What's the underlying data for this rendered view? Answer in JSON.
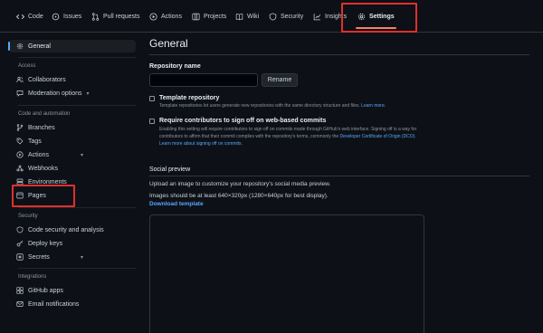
{
  "nav": {
    "tabs": [
      {
        "id": "code",
        "label": "Code",
        "icon": "code-icon"
      },
      {
        "id": "issues",
        "label": "Issues",
        "icon": "issue-icon"
      },
      {
        "id": "pulls",
        "label": "Pull requests",
        "icon": "pull-request-icon"
      },
      {
        "id": "actions",
        "label": "Actions",
        "icon": "play-icon"
      },
      {
        "id": "projects",
        "label": "Projects",
        "icon": "table-icon"
      },
      {
        "id": "wiki",
        "label": "Wiki",
        "icon": "book-icon"
      },
      {
        "id": "security",
        "label": "Security",
        "icon": "shield-icon"
      },
      {
        "id": "insights",
        "label": "Insights",
        "icon": "graph-icon"
      },
      {
        "id": "settings",
        "label": "Settings",
        "icon": "gear-icon",
        "active": true
      }
    ]
  },
  "sidebar": {
    "general": "General",
    "access_heading": "Access",
    "collaborators": "Collaborators",
    "moderation": "Moderation options",
    "code_heading": "Code and automation",
    "branches": "Branches",
    "tags": "Tags",
    "actions": "Actions",
    "webhooks": "Webhooks",
    "environments": "Environments",
    "pages": "Pages",
    "security_heading": "Security",
    "code_security": "Code security and analysis",
    "deploy_keys": "Deploy keys",
    "secrets": "Secrets",
    "integrations_heading": "Integrations",
    "github_apps": "GitHub apps",
    "email_notifications": "Email notifications"
  },
  "main": {
    "title": "General",
    "repo_name_label": "Repository name",
    "repo_name_value": "",
    "rename_button": "Rename",
    "template": {
      "label": "Template repository",
      "desc": "Template repositories let users generate new repositories with the same directory structure and files.",
      "link": "Learn more."
    },
    "signoff": {
      "label": "Require contributors to sign off on web-based commits",
      "desc1": "Enabling this setting will require contributors to sign off on commits made through GitHub's web interface. Signing off is a way for",
      "desc2": "contributors to affirm that their commit complies with the repository's terms, commonly the",
      "desc2_link": "Developer Certificate of Origin (DCO).",
      "link": "Learn more about signing off on commits."
    },
    "social_preview": {
      "heading": "Social preview",
      "desc1": "Upload an image to customize your repository's social media preview.",
      "desc2": "Images should be at least 640×320px (1280×640px for best display).",
      "download": "Download template"
    }
  },
  "colors": {
    "background": "#0d1117",
    "accent_link": "#58a6ff",
    "active_underline": "#f78166",
    "highlight_box": "#e0302a"
  }
}
